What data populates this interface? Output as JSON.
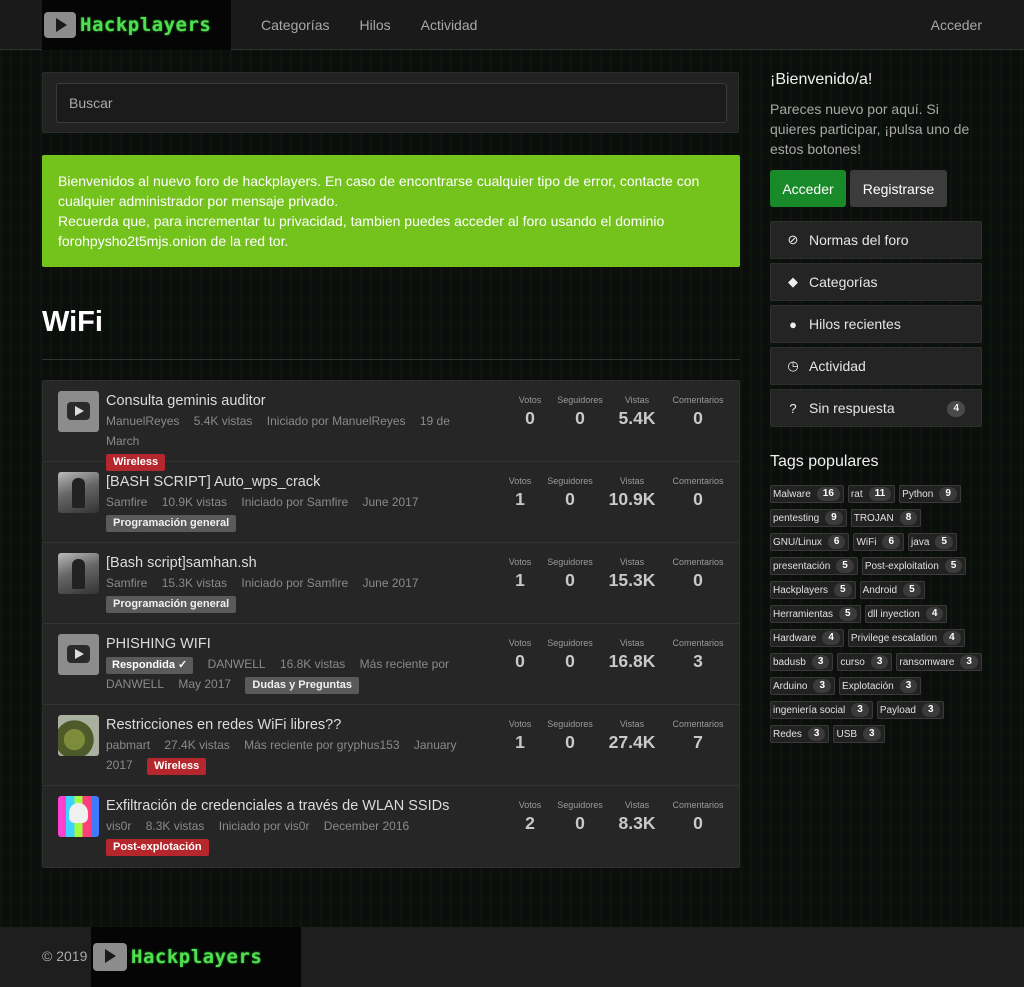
{
  "colors": {
    "accent_green": "#74c21c",
    "button_green": "#198a2a",
    "tag_red": "#b5272c",
    "logo_green": "#4fe04f"
  },
  "header": {
    "logo_text": "Hackplayers",
    "nav": [
      "Categorías",
      "Hilos",
      "Actividad"
    ],
    "login": "Acceder"
  },
  "search": {
    "placeholder": "Buscar"
  },
  "alert": {
    "line1": "Bienvenidos al nuevo foro de hackplayers. En caso de encontrarse cualquier tipo de error, contacte con cualquier administrador por mensaje privado.",
    "line2": "Recuerda que, para incrementar tu privacidad, tambien puedes acceder al foro usando el dominio forohpysho2t5mjs.onion de la red tor."
  },
  "page_title": "WiFi",
  "stat_labels": {
    "votes": "Votos",
    "followers": "Seguidores",
    "views": "Vistas",
    "comments": "Comentarios"
  },
  "topics": [
    {
      "title": "Consulta geminis auditor",
      "author": "ManuelReyes",
      "views_text": "5.4K vistas",
      "started": "Iniciado por ManuelReyes",
      "date": "19 de March",
      "tag": "Wireless",
      "votes": "0",
      "followers": "0",
      "views": "5.4K",
      "comments": "0"
    },
    {
      "title": "[BASH SCRIPT] Auto_wps_crack",
      "author": "Samfire",
      "views_text": "10.9K vistas",
      "started": "Iniciado por Samfire",
      "date": "June 2017",
      "tag": "Programación general",
      "votes": "1",
      "followers": "0",
      "views": "10.9K",
      "comments": "0"
    },
    {
      "title": "[Bash script]samhan.sh",
      "author": "Samfire",
      "views_text": "15.3K vistas",
      "started": "Iniciado por Samfire",
      "date": "June 2017",
      "tag": "Programación general",
      "votes": "1",
      "followers": "0",
      "views": "15.3K",
      "comments": "0"
    },
    {
      "title": "PHISHING WIFI",
      "answered": "Respondida ✓",
      "author": "DANWELL",
      "views_text": "16.8K vistas",
      "started": "Más reciente por",
      "started_by": "DANWELL",
      "date": "May 2017",
      "tag": "Dudas y Preguntas",
      "votes": "0",
      "followers": "0",
      "views": "16.8K",
      "comments": "3"
    },
    {
      "title": "Restricciones en redes WiFi libres??",
      "author": "pabmart",
      "views_text": "27.4K vistas",
      "started": "Más reciente por gryphus153",
      "date": "January 2017",
      "tag": "Wireless",
      "votes": "1",
      "followers": "0",
      "views": "27.4K",
      "comments": "7"
    },
    {
      "title": "Exfiltración de credenciales a través de WLAN SSIDs",
      "author": "vis0r",
      "views_text": "8.3K vistas",
      "started": "Iniciado por vis0r",
      "date": "December 2016",
      "tag": "Post-explotación",
      "votes": "2",
      "followers": "0",
      "views": "8.3K",
      "comments": "0"
    }
  ],
  "sidebar": {
    "welcome_title": "¡Bienvenido/a!",
    "welcome_text": "Pareces nuevo por aquí. Si quieres participar, ¡pulsa uno de estos botones!",
    "signin_button": "Acceder",
    "register_button": "Registrarse",
    "menu": [
      {
        "label": "Normas del foro",
        "icon": "ban-icon"
      },
      {
        "label": "Categorías",
        "icon": "tags-icon"
      },
      {
        "label": "Hilos recientes",
        "icon": "comments-icon"
      },
      {
        "label": "Actividad",
        "icon": "clock-icon"
      },
      {
        "label": "Sin respuesta",
        "icon": "question-icon",
        "count": "4"
      }
    ],
    "tags_title": "Tags populares",
    "tags": [
      {
        "name": "Malware",
        "count": "16"
      },
      {
        "name": "rat",
        "count": "11"
      },
      {
        "name": "Python",
        "count": "9"
      },
      {
        "name": "pentesting",
        "count": "9"
      },
      {
        "name": "TROJAN",
        "count": "8"
      },
      {
        "name": "GNU/Linux",
        "count": "6"
      },
      {
        "name": "WiFi",
        "count": "6"
      },
      {
        "name": "java",
        "count": "5"
      },
      {
        "name": "presentación",
        "count": "5"
      },
      {
        "name": "Post-exploitation",
        "count": "5"
      },
      {
        "name": "Hackplayers",
        "count": "5"
      },
      {
        "name": "Android",
        "count": "5"
      },
      {
        "name": "Herramientas",
        "count": "5"
      },
      {
        "name": "dll inyection",
        "count": "4"
      },
      {
        "name": "Hardware",
        "count": "4"
      },
      {
        "name": "Privilege escalation",
        "count": "4"
      },
      {
        "name": "badusb",
        "count": "3"
      },
      {
        "name": "curso",
        "count": "3"
      },
      {
        "name": "ransomware",
        "count": "3"
      },
      {
        "name": "Arduino",
        "count": "3"
      },
      {
        "name": "Explotación",
        "count": "3"
      },
      {
        "name": "ingeniería social",
        "count": "3"
      },
      {
        "name": "Payload",
        "count": "3"
      },
      {
        "name": "Redes",
        "count": "3"
      },
      {
        "name": "USB",
        "count": "3"
      }
    ]
  },
  "footer": {
    "copyright": "© 2019",
    "logo_text": "Hackplayers"
  }
}
